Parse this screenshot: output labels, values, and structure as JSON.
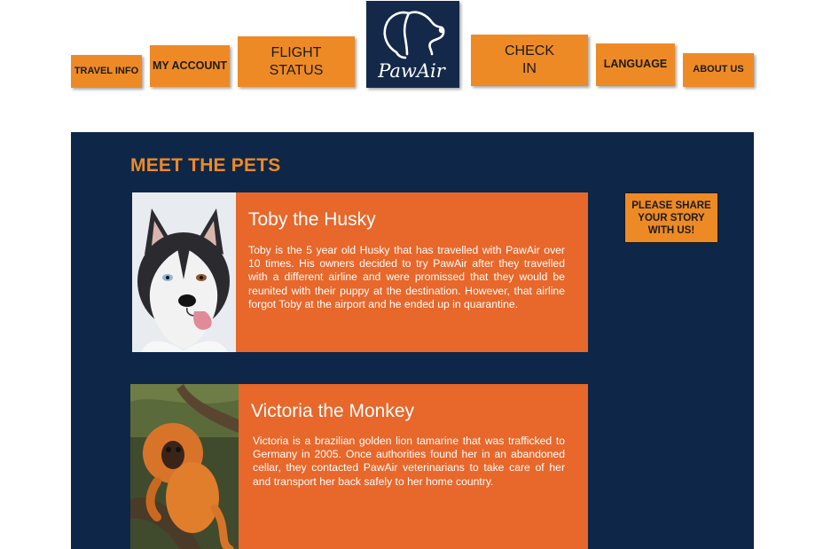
{
  "nav": {
    "travel_info": "TRAVEL INFO",
    "my_account": "MY ACCOUNT",
    "flight_status_line1": "FLIGHT",
    "flight_status_line2": "STATUS",
    "check_in_line1": "CHECK",
    "check_in_line2": "IN",
    "language": "LANGUAGE",
    "about_us": "ABOUT US"
  },
  "logo": {
    "text": "PawAir"
  },
  "main": {
    "title": "MEET THE PETS",
    "share_line1": "PLEASE SHARE",
    "share_line2": "YOUR STORY",
    "share_line3": "WITH US!"
  },
  "pets": [
    {
      "name": "Toby the Husky",
      "description": "Toby is the 5 year old Husky that has travelled with PawAir over 10 times. His owners decided to try PawAir after they travelled with a different airline and were promissed that they would be reunited with their puppy at the destination. However, that airline forgot Toby at the airport and he ended up in quarantine."
    },
    {
      "name": "Victoria the Monkey",
      "description": "Victoria is a brazilian golden lion tamarine that was trafficked to Germany in 2005. Once authorities found her in an abandoned cellar, they contacted PawAir veterinarians to take care of her and transport her back safely to her home country."
    }
  ],
  "colors": {
    "nav_orange": "#ee8a25",
    "panel_navy": "#0e2647",
    "card_orange": "#e8672a",
    "logo_navy": "#14294a"
  }
}
